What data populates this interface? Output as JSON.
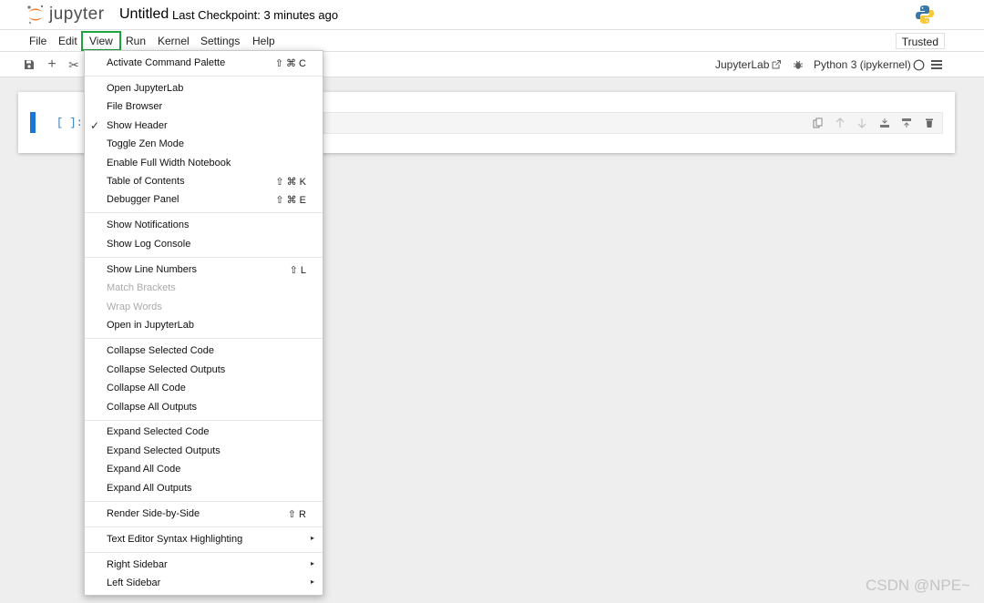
{
  "header": {
    "logo_text": "jupyter",
    "notebook_title": "Untitled",
    "checkpoint": "Last Checkpoint: 3 minutes ago"
  },
  "menubar": {
    "items": [
      "File",
      "Edit",
      "View",
      "Run",
      "Kernel",
      "Settings",
      "Help"
    ],
    "trusted": "Trusted"
  },
  "toolbar": {
    "jupyterlab_link": "JupyterLab",
    "kernel": "Python 3 (ipykernel)"
  },
  "cell": {
    "prompt": "[ ]:"
  },
  "view_menu": {
    "items": [
      {
        "label": "Activate Command Palette",
        "shortcut": "⇧ ⌘ C"
      },
      {
        "label": "Open JupyterLab"
      },
      {
        "label": "File Browser"
      },
      {
        "label": "Show Header",
        "checked": true
      },
      {
        "label": "Toggle Zen Mode"
      },
      {
        "label": "Enable Full Width Notebook"
      },
      {
        "label": "Table of Contents",
        "shortcut": "⇧ ⌘ K"
      },
      {
        "label": "Debugger Panel",
        "shortcut": "⇧ ⌘ E"
      },
      {
        "label": "Show Notifications"
      },
      {
        "label": "Show Log Console"
      },
      {
        "label": "Show Line Numbers",
        "shortcut": "⇧ L"
      },
      {
        "label": "Match Brackets",
        "disabled": true
      },
      {
        "label": "Wrap Words",
        "disabled": true
      },
      {
        "label": "Open in JupyterLab"
      },
      {
        "label": "Collapse Selected Code"
      },
      {
        "label": "Collapse Selected Outputs"
      },
      {
        "label": "Collapse All Code"
      },
      {
        "label": "Collapse All Outputs"
      },
      {
        "label": "Expand Selected Code"
      },
      {
        "label": "Expand Selected Outputs"
      },
      {
        "label": "Expand All Code"
      },
      {
        "label": "Expand All Outputs"
      },
      {
        "label": "Render Side-by-Side",
        "shortcut": "⇧ R"
      },
      {
        "label": "Text Editor Syntax Highlighting",
        "submenu": true
      },
      {
        "label": "Right Sidebar",
        "submenu": true
      },
      {
        "label": "Left Sidebar",
        "submenu": true
      }
    ]
  },
  "watermark": "CSDN @NPE~",
  "colors": {
    "cell_active_bar": "#1976d2",
    "view_highlight": "#1fa341",
    "prompt": "#307fc1",
    "logo_orange": "#f37726"
  }
}
